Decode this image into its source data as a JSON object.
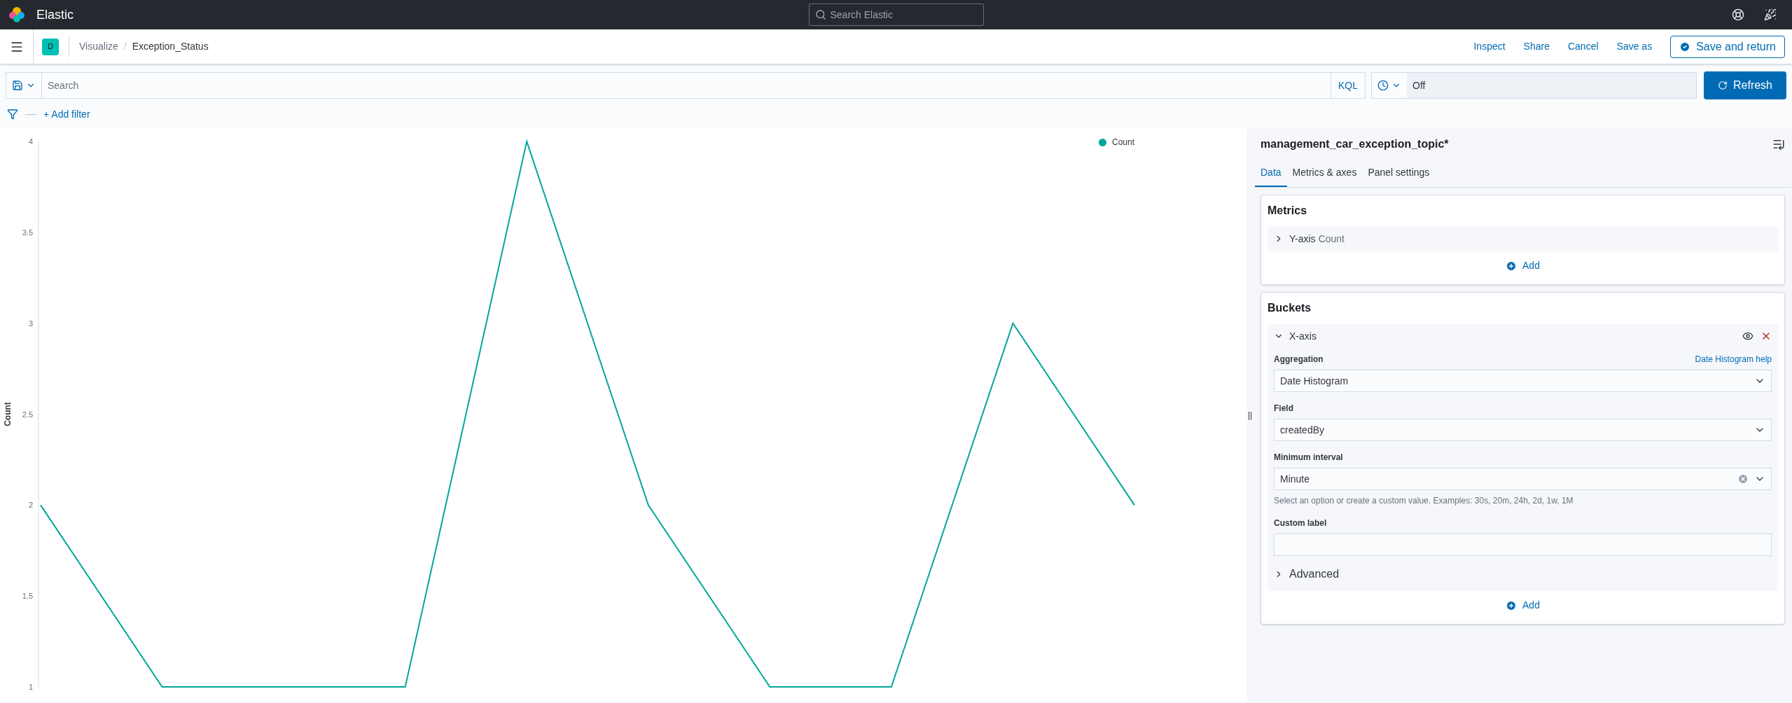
{
  "header": {
    "brand": "Elastic",
    "search_placeholder": "Search Elastic"
  },
  "nav": {
    "space": "D",
    "breadcrumbs": [
      "Visualize",
      "Exception_Status"
    ],
    "separator": "/",
    "actions": [
      "Inspect",
      "Share",
      "Cancel",
      "Save as"
    ],
    "primary_action": "Save and return"
  },
  "query": {
    "placeholder": "Search",
    "language": "KQL",
    "refresh_interval": "Off",
    "refresh_button": "Refresh"
  },
  "filters": {
    "separator": "—",
    "add": "+ Add filter"
  },
  "chart_data": {
    "type": "line",
    "ylabel": "Count",
    "series": [
      {
        "name": "Count",
        "color": "#00a69b",
        "values": [
          2,
          1,
          1,
          1,
          4,
          2,
          1,
          1,
          3,
          2
        ]
      }
    ],
    "ylim": [
      1,
      4
    ],
    "yticks": [
      1,
      1.5,
      2,
      2.5,
      3,
      3.5,
      4
    ]
  },
  "editor": {
    "index": "management_car_exception_topic*",
    "tabs": [
      {
        "label": "Data",
        "selected": true
      },
      {
        "label": "Metrics & axes",
        "selected": false
      },
      {
        "label": "Panel settings",
        "selected": false
      }
    ],
    "metrics": {
      "title": "Metrics",
      "items": [
        {
          "axis": "Y-axis",
          "agg": "Count",
          "expanded": false
        }
      ],
      "add": "Add"
    },
    "buckets": {
      "title": "Buckets",
      "items": [
        {
          "axis": "X-axis",
          "expanded": true,
          "fields": [
            {
              "kind": "select",
              "label": "Aggregation",
              "help_link": "Date Histogram help",
              "value": "Date Histogram"
            },
            {
              "kind": "select",
              "label": "Field",
              "value": "createdBy"
            },
            {
              "kind": "combo",
              "label": "Minimum interval",
              "value": "Minute",
              "hint": "Select an option or create a custom value. Examples: 30s, 20m, 24h, 2d, 1w, 1M"
            },
            {
              "kind": "text",
              "label": "Custom label"
            }
          ],
          "advanced": {
            "label": "Advanced",
            "expanded": false
          }
        }
      ],
      "add": "Add"
    }
  }
}
